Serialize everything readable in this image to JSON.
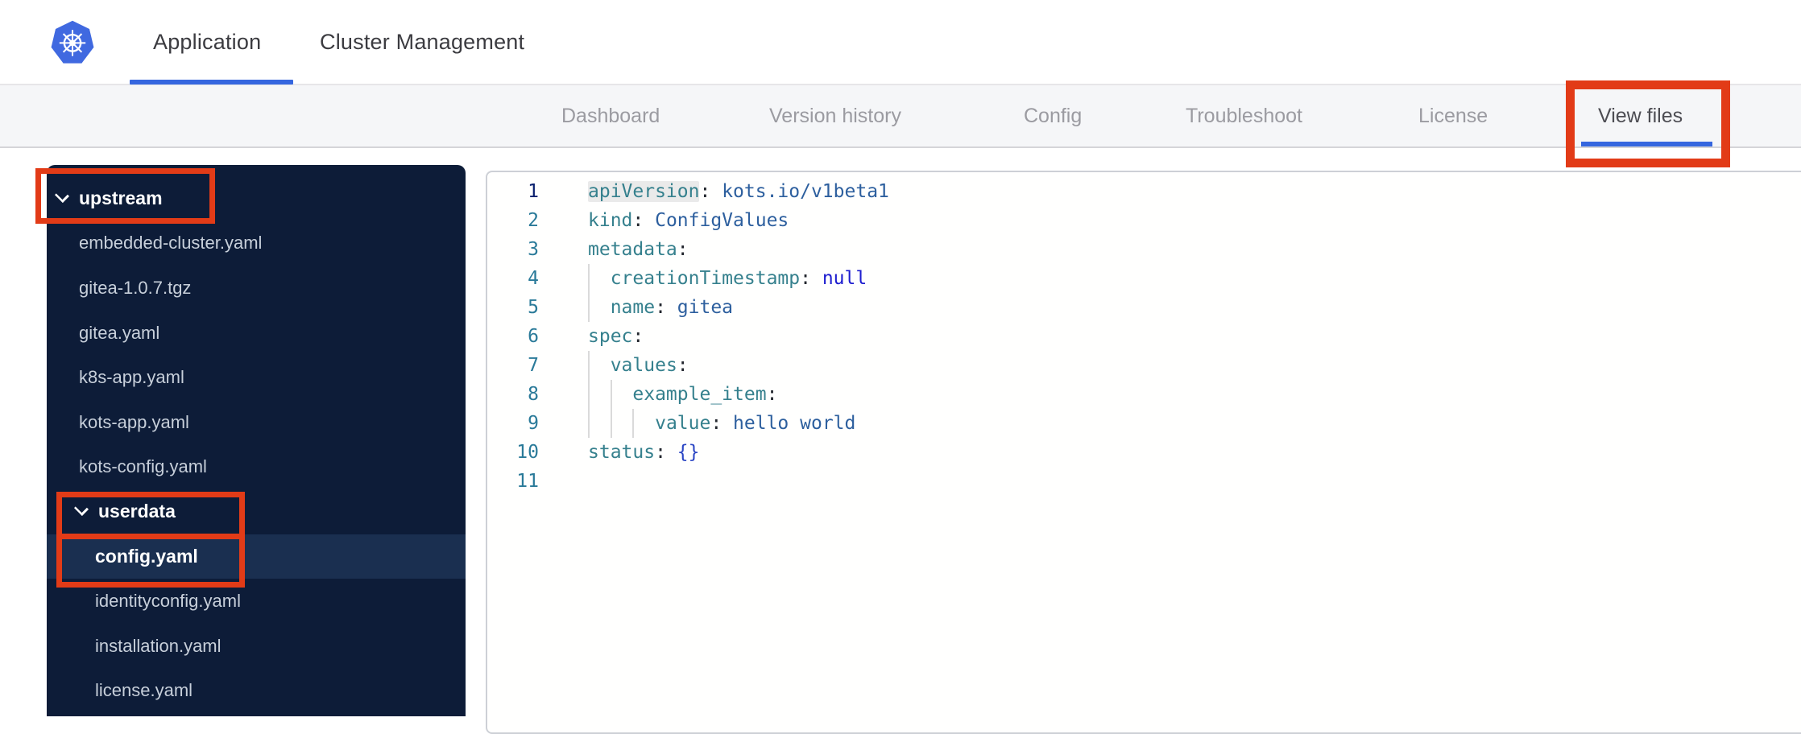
{
  "topbar": {
    "logo_icon": "kubernetes-logo",
    "tabs": [
      {
        "label": "Application",
        "active": true
      },
      {
        "label": "Cluster Management",
        "active": false
      }
    ]
  },
  "subnav": {
    "items": [
      {
        "label": "Dashboard",
        "active": false
      },
      {
        "label": "Version history",
        "active": false
      },
      {
        "label": "Config",
        "active": false
      },
      {
        "label": "Troubleshoot",
        "active": false
      },
      {
        "label": "License",
        "active": false
      },
      {
        "label": "View files",
        "active": true
      }
    ]
  },
  "sidebar": {
    "tree": [
      {
        "label": "upstream",
        "kind": "folder",
        "level": 0,
        "expanded": true
      },
      {
        "label": "embedded-cluster.yaml",
        "kind": "file",
        "level": 1
      },
      {
        "label": "gitea-1.0.7.tgz",
        "kind": "file",
        "level": 1
      },
      {
        "label": "gitea.yaml",
        "kind": "file",
        "level": 1
      },
      {
        "label": "k8s-app.yaml",
        "kind": "file",
        "level": 1
      },
      {
        "label": "kots-app.yaml",
        "kind": "file",
        "level": 1
      },
      {
        "label": "kots-config.yaml",
        "kind": "file",
        "level": 1
      },
      {
        "label": "userdata",
        "kind": "folder",
        "level": 1,
        "expanded": true
      },
      {
        "label": "config.yaml",
        "kind": "file",
        "level": 2,
        "selected": true
      },
      {
        "label": "identityconfig.yaml",
        "kind": "file",
        "level": 2
      },
      {
        "label": "installation.yaml",
        "kind": "file",
        "level": 2
      },
      {
        "label": "license.yaml",
        "kind": "file",
        "level": 2
      }
    ]
  },
  "editor": {
    "language": "yaml",
    "lines": [
      {
        "n": 1,
        "active": true,
        "guides": 0,
        "seg": [
          {
            "c": "key",
            "hl": true,
            "t": "apiVersion"
          },
          {
            "c": "p",
            "t": ": "
          },
          {
            "c": "val",
            "t": "kots.io/v1beta1"
          }
        ]
      },
      {
        "n": 2,
        "guides": 0,
        "seg": [
          {
            "c": "key",
            "t": "kind"
          },
          {
            "c": "p",
            "t": ": "
          },
          {
            "c": "val",
            "t": "ConfigValues"
          }
        ]
      },
      {
        "n": 3,
        "guides": 0,
        "seg": [
          {
            "c": "key",
            "t": "metadata"
          },
          {
            "c": "p",
            "t": ":"
          }
        ]
      },
      {
        "n": 4,
        "guides": 1,
        "seg": [
          {
            "c": "p",
            "t": "  "
          },
          {
            "c": "key",
            "t": "creationTimestamp"
          },
          {
            "c": "p",
            "t": ": "
          },
          {
            "c": "kw",
            "t": "null"
          }
        ]
      },
      {
        "n": 5,
        "guides": 1,
        "seg": [
          {
            "c": "p",
            "t": "  "
          },
          {
            "c": "key",
            "t": "name"
          },
          {
            "c": "p",
            "t": ": "
          },
          {
            "c": "val",
            "t": "gitea"
          }
        ]
      },
      {
        "n": 6,
        "guides": 0,
        "seg": [
          {
            "c": "key",
            "t": "spec"
          },
          {
            "c": "p",
            "t": ":"
          }
        ]
      },
      {
        "n": 7,
        "guides": 1,
        "seg": [
          {
            "c": "p",
            "t": "  "
          },
          {
            "c": "key",
            "t": "values"
          },
          {
            "c": "p",
            "t": ":"
          }
        ]
      },
      {
        "n": 8,
        "guides": 2,
        "seg": [
          {
            "c": "p",
            "t": "    "
          },
          {
            "c": "key",
            "t": "example_item"
          },
          {
            "c": "p",
            "t": ":"
          }
        ]
      },
      {
        "n": 9,
        "guides": 3,
        "seg": [
          {
            "c": "p",
            "t": "      "
          },
          {
            "c": "key",
            "t": "value"
          },
          {
            "c": "p",
            "t": ": "
          },
          {
            "c": "val",
            "t": "hello world"
          }
        ]
      },
      {
        "n": 10,
        "guides": 0,
        "seg": [
          {
            "c": "key",
            "t": "status"
          },
          {
            "c": "p",
            "t": ": "
          },
          {
            "c": "br",
            "t": "{}"
          }
        ]
      },
      {
        "n": 11,
        "guides": 0,
        "seg": []
      }
    ]
  },
  "annotations": [
    {
      "target": "upstream folder row"
    },
    {
      "target": "userdata folder row"
    },
    {
      "target": "config.yaml file row"
    },
    {
      "target": "View files nav tab"
    }
  ],
  "colors": {
    "accent_blue": "#3566df",
    "annotation_red": "#e23b17",
    "sidebar_bg": "#0d1c38",
    "sidebar_selected_bg": "#1a2f50",
    "code_key": "#35808d",
    "code_value": "#2d5f9e",
    "code_keyword": "#1d1dcf",
    "line_number": "#2a7a99",
    "active_line_number": "#0b216f"
  }
}
